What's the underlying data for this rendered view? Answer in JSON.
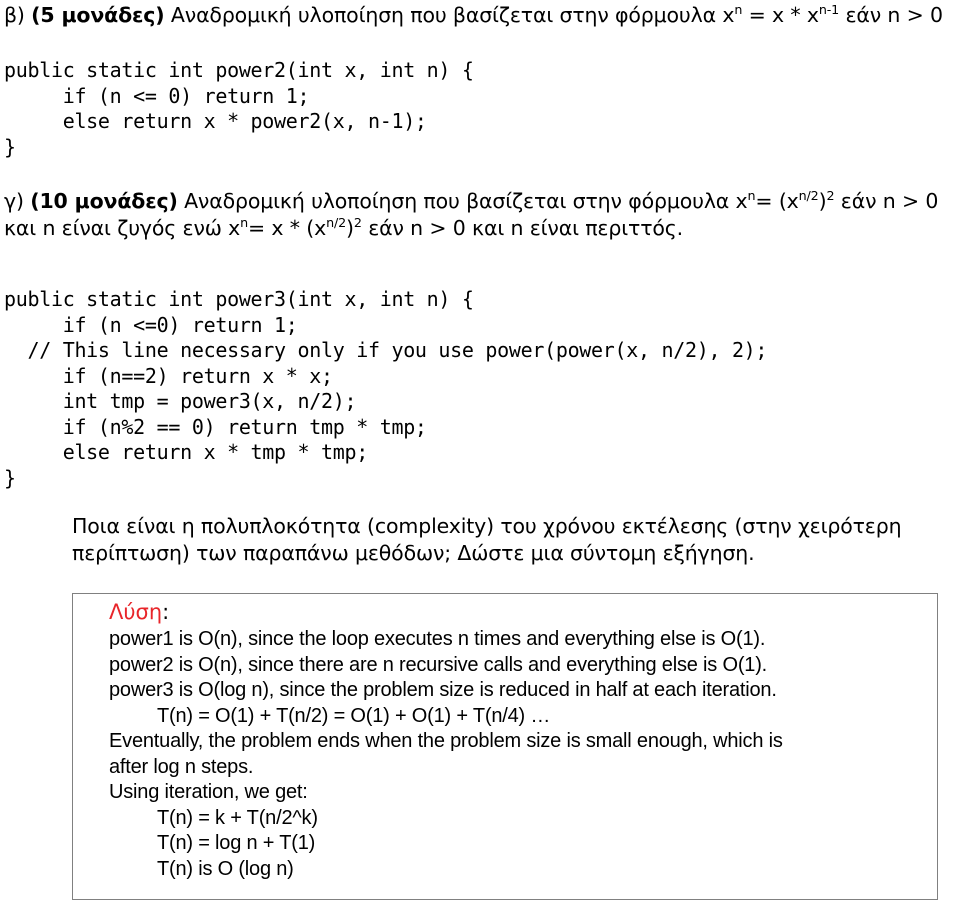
{
  "document": {
    "section_b": {
      "marker": "β)",
      "points_label": "(5 μονάδες)",
      "text_part1": "Αναδρομική υλοποίηση που βασίζεται στην φόρμουλα x",
      "sup1": "n",
      "text_part2": " = x * x",
      "sup2": "n-1",
      "text_part3": " εάν n > 0",
      "code": "public static int power2(int x, int n) {\n     if (n <= 0) return 1;\n     else return x * power2(x, n-1);\n}"
    },
    "section_c": {
      "marker": "γ)",
      "points_label": "(10 μονάδες)",
      "text_part1": "Αναδρομική υλοποίηση που βασίζεται στην φόρμουλα x",
      "sup1": "n",
      "text_part2": "= (x",
      "sup2": "n/2",
      "text_part3": ")",
      "sup3": "2",
      "text_part4": "  εάν n > 0 και n είναι ζυγός ενώ x",
      "sup4": "n",
      "text_part5": "= x * (x",
      "sup5": "n/2",
      "text_part6": ")",
      "sup6": "2",
      "text_part7": " εάν  n > 0 και n είναι περιττός.",
      "code": "public static int power3(int x, int n) {\n     if (n <=0) return 1;\n  // This line necessary only if you use power(power(x, n/2), 2);\n     if (n==2) return x * x;\n     int tmp = power3(x, n/2);\n     if (n%2 == 0) return tmp * tmp;\n     else return x * tmp * tmp;\n}"
    },
    "question": {
      "line1": "Ποια είναι η πολυπλοκότητα (complexity) του χρόνου εκτέλεσης (στην χειρότερη",
      "line2": "περίπτωση) των παραπάνω μεθόδων; Δώστε μια σύντομη εξήγηση."
    },
    "solution": {
      "title_word": "Λύση",
      "title_colon": ":",
      "title_color": "#e8252a",
      "border_color": "#808080",
      "lines": [
        {
          "text": "power1 is O(n), since the loop executes n times and everything else is O(1).",
          "indent": 1
        },
        {
          "text": "power2 is O(n), since there are n recursive calls and everything else is O(1).",
          "indent": 1
        },
        {
          "text": "power3 is O(log n), since the problem size is reduced in half at each iteration.",
          "indent": 1
        },
        {
          "text": "T(n) = O(1) + T(n/2) = O(1) + O(1) + T(n/4) …",
          "indent": 2
        },
        {
          "text": "Eventually, the problem ends when the problem size is small enough, which is",
          "indent": 1
        },
        {
          "text": "after log n steps.",
          "indent": 1
        },
        {
          "text": "Using iteration, we get:",
          "indent": 1
        },
        {
          "text": "T(n) = k + T(n/2^k)",
          "indent": 2
        },
        {
          "text": "T(n) = log n + T(1)",
          "indent": 2
        },
        {
          "text": "T(n) is O (log n)",
          "indent": 2
        }
      ]
    }
  }
}
